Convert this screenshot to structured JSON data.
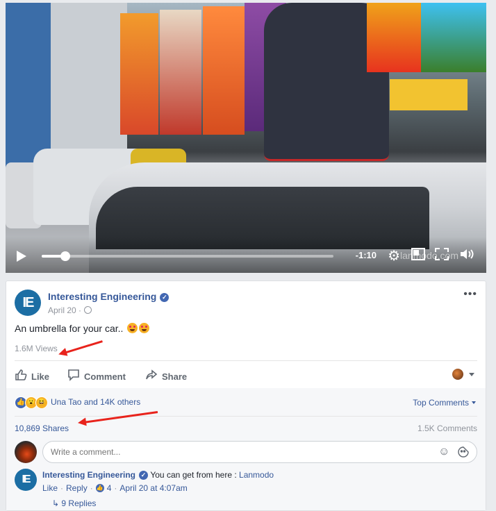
{
  "video": {
    "remaining_time": "-1:10",
    "progress": 0.08,
    "watermark": "lanmodo.com",
    "icons": [
      "play-icon",
      "gear-icon",
      "picture-in-picture-icon",
      "fullscreen-icon",
      "volume-icon"
    ]
  },
  "post": {
    "page_name": "Interesting Engineering",
    "date": "April 20 ·",
    "text": "An umbrella for your car..",
    "views": "1.6M Views",
    "actions": {
      "like": "Like",
      "comment": "Comment",
      "share": "Share"
    },
    "reactions_text": "Una Tao and 14K others",
    "top_comments": "Top Comments",
    "shares": "10,869 Shares",
    "comments_count": "1.5K Comments",
    "comment_placeholder": "Write a comment...",
    "comment": {
      "author": "Interesting Engineering",
      "text": "You can get from here :",
      "link": "Lanmodo",
      "like": "Like",
      "reply": "Reply",
      "likes": "4",
      "time": "April 20 at 4:07am",
      "replies": "9 Replies"
    }
  },
  "colors": {
    "link": "#365899",
    "accent": "#4267b2",
    "annotation_arrow": "#e8231c"
  }
}
